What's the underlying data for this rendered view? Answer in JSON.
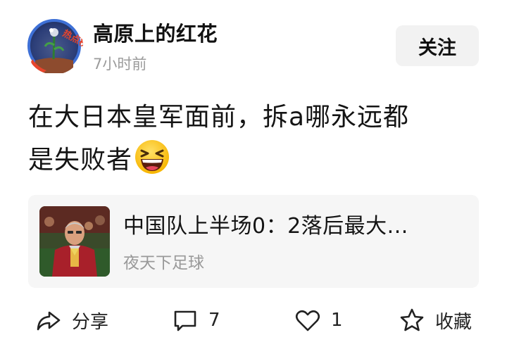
{
  "post": {
    "author": "高原上的红花",
    "avatar_badge": "热点榜",
    "time": "7小时前",
    "follow_label": "关注",
    "text_line1": "在大日本皇军面前，拆a哪永远都",
    "text_line2": "是失败者",
    "emoji": "grinning-squinting-face"
  },
  "link_card": {
    "title": "中国队上半场0：2落后最大...",
    "source": "夜天下足球",
    "thumbnail": "soccer-coach-photo"
  },
  "actions": {
    "share_label": "分享",
    "comment_count": "7",
    "like_count": "1",
    "favorite_label": "收藏"
  },
  "icons": {
    "share": "share-arrow-icon",
    "comment": "comment-bubble-icon",
    "like": "heart-icon",
    "favorite": "star-icon"
  },
  "colors": {
    "text": "#111111",
    "muted": "#9b9b9b",
    "follow_bg": "#f2f2f2",
    "card_bg": "#f6f6f6",
    "badge": "#e8452c"
  }
}
